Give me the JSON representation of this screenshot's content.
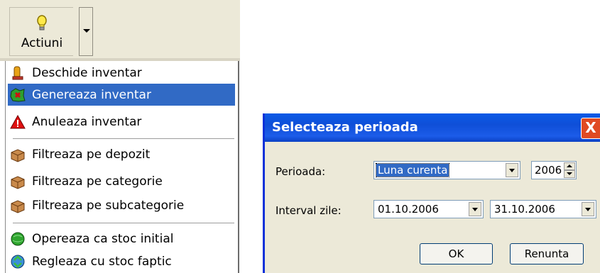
{
  "toolbar": {
    "actions_label": "Actiuni",
    "bulb_icon": "lightbulb-icon",
    "dropdown_icon": "chevron-down-icon"
  },
  "menu": {
    "items": [
      {
        "label": "Deschide inventar",
        "icon": "open-inventory-icon",
        "selected": false
      },
      {
        "label": "Genereaza inventar",
        "icon": "generate-inventory-icon",
        "selected": true
      },
      {
        "label": "Anuleaza inventar",
        "icon": "warning-icon",
        "selected": false
      },
      {
        "label": "Filtreaza pe depozit",
        "icon": "box-icon",
        "selected": false
      },
      {
        "label": "Filtreaza pe categorie",
        "icon": "box-icon",
        "selected": false
      },
      {
        "label": "Filtreaza pe subcategorie",
        "icon": "box-icon",
        "selected": false
      },
      {
        "label": "Opereaza ca stoc initial",
        "icon": "green-globe-icon",
        "selected": false
      },
      {
        "label": "Regleaza cu stoc faptic",
        "icon": "recycle-icon",
        "selected": false
      }
    ]
  },
  "dialog": {
    "title": "Selecteaza perioada",
    "close_label": "X",
    "period_label": "Perioada:",
    "period_value": "Luna curenta",
    "year_value": "2006",
    "interval_label": "Interval zile:",
    "date_from": "01.10.2006",
    "date_to": "31.10.2006",
    "ok_label": "OK",
    "cancel_label": "Renunta"
  },
  "colors": {
    "selection": "#316ac5",
    "titlebar": "#0a5ae6",
    "close": "#e04a23",
    "window_bg": "#ece9d8"
  }
}
